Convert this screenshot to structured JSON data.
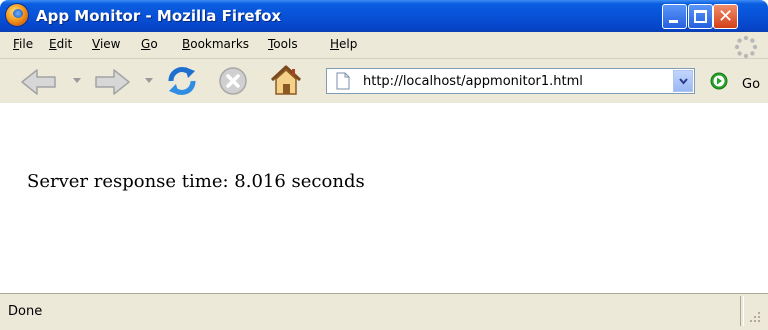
{
  "window": {
    "title": "App Monitor - Mozilla Firefox"
  },
  "menu": {
    "items": [
      {
        "pre": "",
        "u": "F",
        "post": "ile"
      },
      {
        "pre": "",
        "u": "E",
        "post": "dit"
      },
      {
        "pre": "",
        "u": "V",
        "post": "iew"
      },
      {
        "pre": "",
        "u": "G",
        "post": "o"
      },
      {
        "pre": "",
        "u": "B",
        "post": "ookmarks"
      },
      {
        "pre": "",
        "u": "T",
        "post": "ools"
      },
      {
        "pre": "",
        "u": "H",
        "post": "elp"
      }
    ]
  },
  "toolbar": {
    "address": "http://localhost/appmonitor1.html",
    "go_label": "Go"
  },
  "page": {
    "message": "Server response time: 8.016 seconds"
  },
  "status": {
    "text": "Done"
  },
  "colors": {
    "titlebar": "#0852d8",
    "chrome": "#ece9d8",
    "close": "#d24018",
    "go": "#2aa02a"
  },
  "icons": [
    "firefox-logo-icon",
    "back-arrow-icon",
    "forward-arrow-icon",
    "dropdown-arrow-icon",
    "reload-icon",
    "stop-icon",
    "home-icon",
    "page-icon",
    "go-icon",
    "throbber-icon",
    "resize-grip-icon"
  ]
}
